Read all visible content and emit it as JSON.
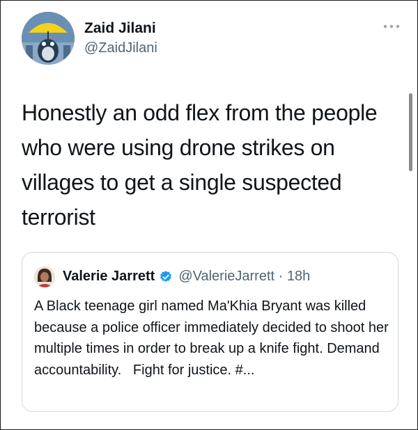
{
  "tweet": {
    "author_name": "Zaid Jilani",
    "author_handle": "@ZaidJilani",
    "more_icon": "more-horizontal-icon",
    "text": "Honestly an odd flex from the people who were using drone strikes on villages to get a single suspected terrorist"
  },
  "quoted": {
    "author_name": "Valerie Jarrett",
    "author_handle": "@ValerieJarrett · 18h",
    "verified_icon": "verified-badge-icon",
    "text": "A Black teenage girl named Ma'Khia Bryant was killed because a police officer immediately decided to shoot her multiple times in order to break up a knife fight. Demand accountability.   Fight for justice. #..."
  },
  "colors": {
    "text": "#0f1419",
    "secondary": "#536471",
    "border": "#cfd9de",
    "verified": "#1d9bf0"
  }
}
